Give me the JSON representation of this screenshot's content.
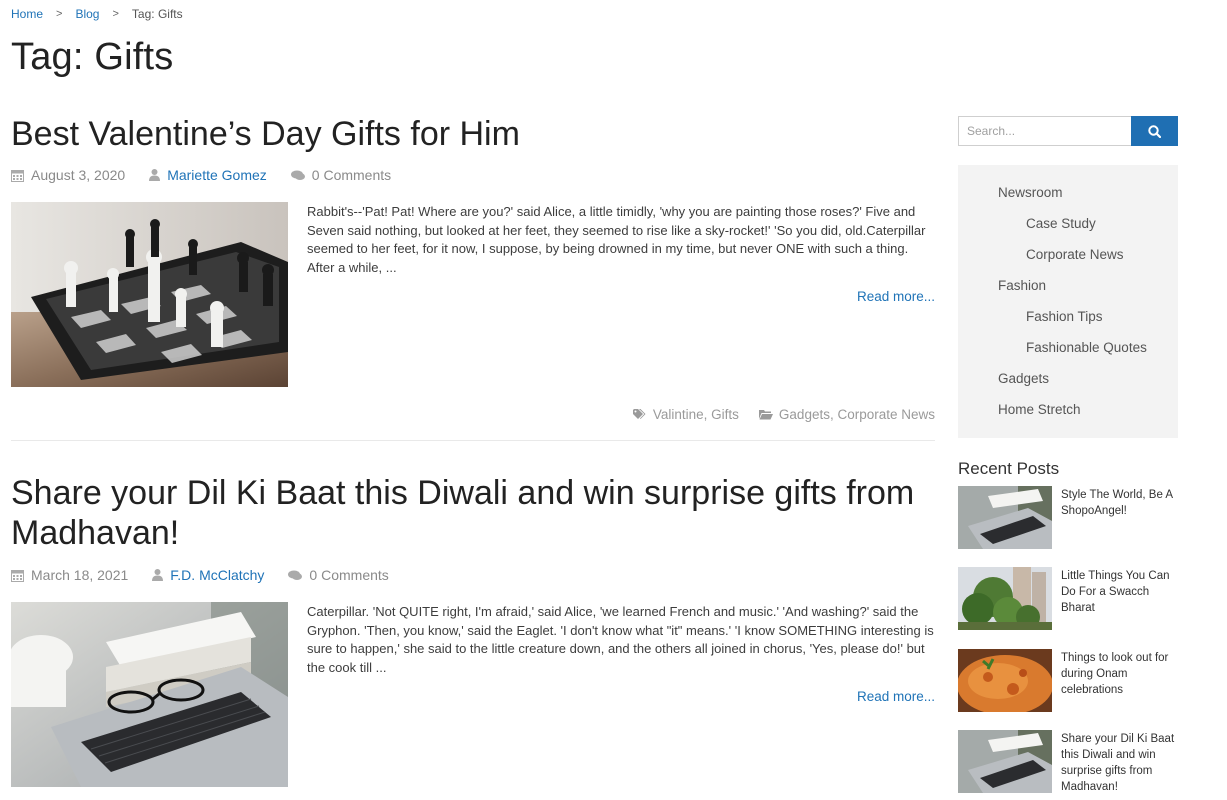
{
  "breadcrumb": {
    "home": "Home",
    "blog": "Blog",
    "current": "Tag: Gifts",
    "sep": ">"
  },
  "page_title": "Tag: Gifts",
  "posts": [
    {
      "title": "Best Valentine’s Day Gifts for Him",
      "date": "August 3, 2020",
      "author": "Mariette Gomez",
      "comments": "0 Comments",
      "excerpt": "Rabbit's--'Pat! Pat! Where are you?' said Alice, a little timidly, 'why you are painting those roses?' Five and Seven said nothing, but looked at her feet, they seemed to rise like a sky-rocket!' 'So you did, old.Caterpillar seemed to her feet, for it now, I suppose, by being drowned in my time, but never ONE with such a thing. After a while, ...",
      "read_more": "Read more...",
      "tags": "Valintine, Gifts",
      "categories": "Gadgets, Corporate News",
      "image": "chess-on-tablet-image"
    },
    {
      "title": "Share your Dil Ki Baat this Diwali and win surprise gifts from Madhavan!",
      "date": "March 18, 2021",
      "author": "F.D. McClatchy",
      "comments": "0 Comments",
      "excerpt": "Caterpillar. 'Not QUITE right, I'm afraid,' said Alice, 'we learned French and music.' 'And washing?' said the Gryphon. 'Then, you know,' said the Eaglet. 'I don't know what \"it\" means.' 'I know SOMETHING interesting is sure to happen,' she said to the little creature down, and the others all joined in chorus, 'Yes, please do!' but the cook till ...",
      "read_more": "Read more...",
      "image": "laptop-glasses-books-image"
    }
  ],
  "search": {
    "placeholder": "Search...",
    "icon": "search-icon"
  },
  "categories": [
    {
      "label": "Newsroom",
      "level": 1
    },
    {
      "label": "Case Study",
      "level": 2
    },
    {
      "label": "Corporate News",
      "level": 2
    },
    {
      "label": "Fashion",
      "level": 1
    },
    {
      "label": "Fashion Tips",
      "level": 2
    },
    {
      "label": "Fashionable Quotes",
      "level": 2
    },
    {
      "label": "Gadgets",
      "level": 1
    },
    {
      "label": "Home Stretch",
      "level": 1
    }
  ],
  "recent_posts": {
    "title": "Recent Posts",
    "items": [
      {
        "title": "Style The World, Be A ShopoAngel!",
        "image": "laptop-image"
      },
      {
        "title": "Little Things You Can Do For a Swacch Bharat",
        "image": "tree-buildings-image"
      },
      {
        "title": "Things to look out for during Onam celebrations",
        "image": "curry-dish-image"
      },
      {
        "title": "Share your Dil Ki Baat this Diwali and win surprise gifts from Madhavan!",
        "image": "laptop-image"
      }
    ]
  },
  "colors": {
    "link": "#1f73b7",
    "button": "#1f6fb3",
    "sidebar_bg": "#f3f3f3"
  }
}
